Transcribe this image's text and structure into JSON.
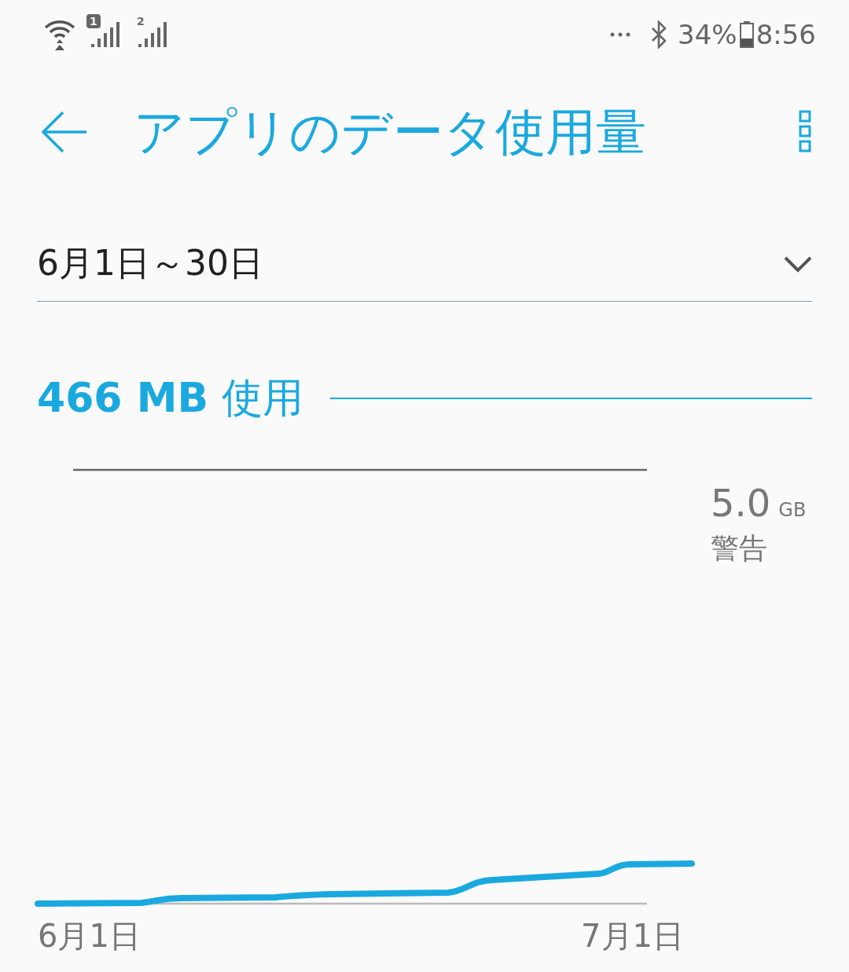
{
  "status_bar": {
    "sims": [
      {
        "label": "1"
      },
      {
        "label": "2"
      }
    ],
    "battery": "34%",
    "time": "8:56"
  },
  "header": {
    "title": "アプリのデータ使用量"
  },
  "period": {
    "value": "6月1日～30日"
  },
  "usage": {
    "amount": "466 MB",
    "suffix": "使用"
  },
  "chart": {
    "warning_value": "5.0",
    "warning_unit": "GB",
    "warning_label": "警告",
    "x_labels": [
      "6月1日",
      "7月1日"
    ]
  }
}
